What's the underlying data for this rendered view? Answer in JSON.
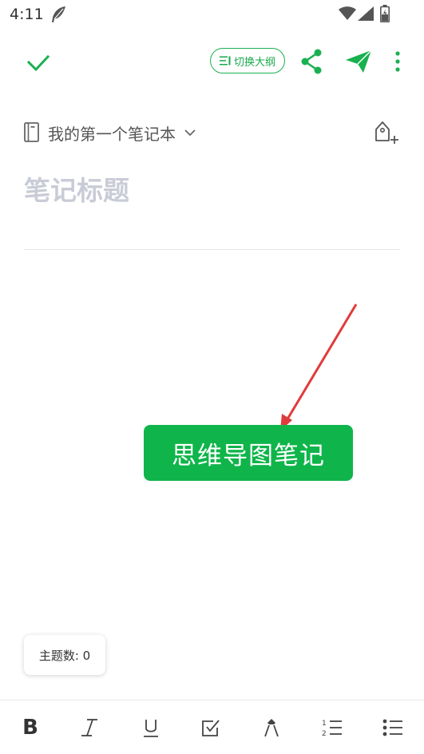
{
  "status_bar": {
    "time": "4:11"
  },
  "toolbar": {
    "outline_toggle_label": "切换大纲"
  },
  "notebook": {
    "name": "我的第一个笔记本"
  },
  "title_field": {
    "placeholder": "笔记标题",
    "value": ""
  },
  "annotation": {
    "label": "思维导图笔记"
  },
  "topic_count": {
    "label": "主题数: 0"
  },
  "format_bar": {
    "bold_label": "B"
  },
  "colors": {
    "accent": "#19b150",
    "annotation_bg": "#0fb54a",
    "arrow": "#e03b3b",
    "placeholder": "#c9ccd6"
  }
}
